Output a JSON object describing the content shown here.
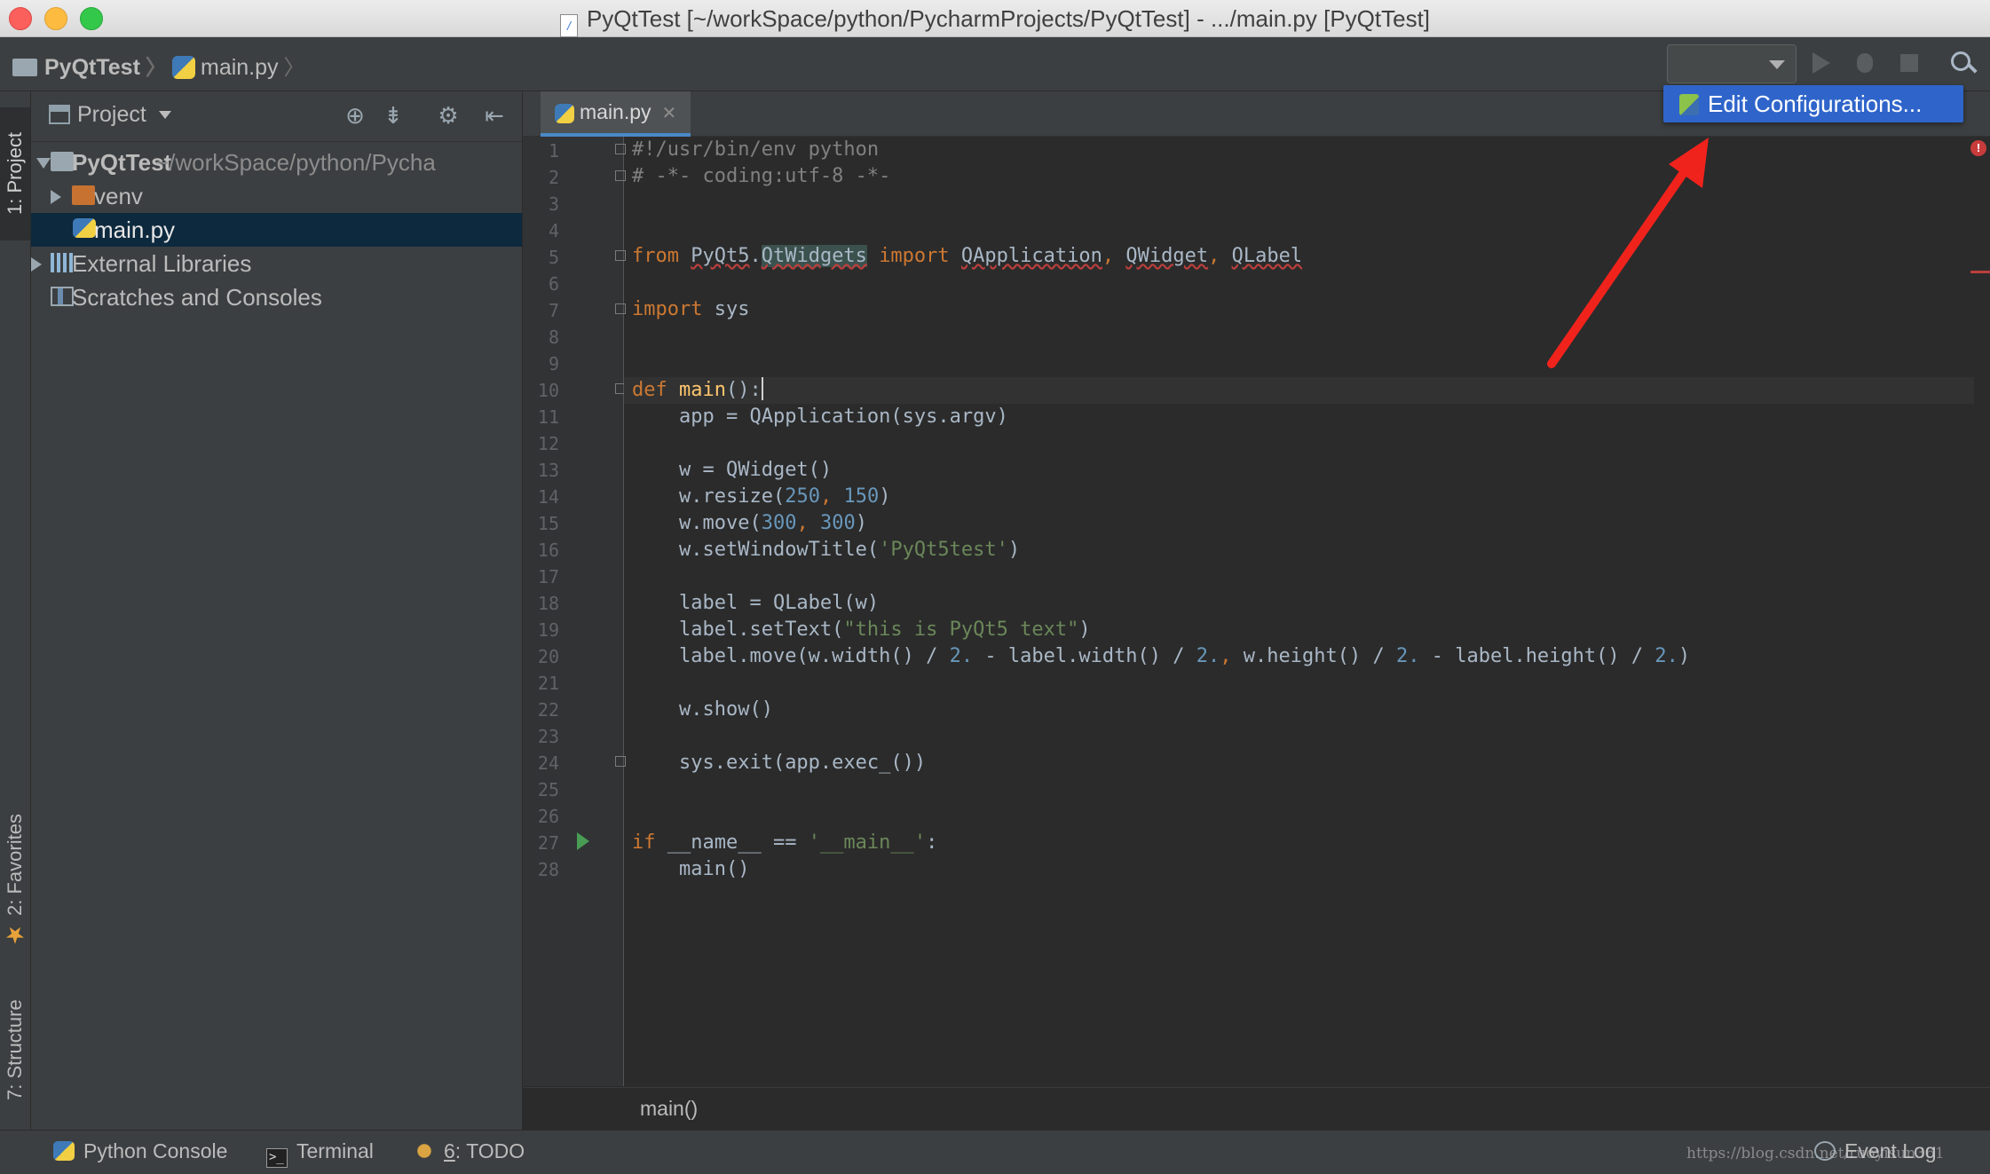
{
  "window": {
    "title": "PyQtTest [~/workSpace/python/PycharmProjects/PyQtTest] - .../main.py [PyQtTest]"
  },
  "navbar": {
    "breadcrumbs": [
      "PyQtTest",
      "main.py"
    ],
    "run_config_selected": "",
    "icons": [
      "run-icon",
      "debug-icon",
      "stop-icon",
      "search-icon"
    ]
  },
  "popup": {
    "edit_configurations_label": "Edit Configurations..."
  },
  "tool_windows": {
    "left": [
      "1: Project",
      "2: Favorites",
      "7: Structure"
    ],
    "bottom": {
      "python_console": "Python Console",
      "terminal": "Terminal",
      "todo_number": "6",
      "todo_label": ": TODO",
      "event_log": "Event Log"
    }
  },
  "project_panel": {
    "title": "Project",
    "tree": [
      {
        "label": "PyQtTest",
        "hint": "~/workSpace/python/Pycha",
        "expanded": true,
        "icon": "folder-icon"
      },
      {
        "label": "venv",
        "expanded": false,
        "icon": "folder-icon"
      },
      {
        "label": "main.py",
        "selected": true,
        "icon": "python-file-icon"
      },
      {
        "label": "External Libraries",
        "expanded": false,
        "icon": "library-icon"
      },
      {
        "label": "Scratches and Consoles",
        "icon": "scratches-icon"
      }
    ]
  },
  "editor": {
    "tab_label": "main.py",
    "line_numbers": [
      "1",
      "2",
      "3",
      "4",
      "5",
      "6",
      "7",
      "8",
      "9",
      "10",
      "11",
      "12",
      "13",
      "14",
      "15",
      "16",
      "17",
      "18",
      "19",
      "20",
      "21",
      "22",
      "23",
      "24",
      "25",
      "26",
      "27",
      "28"
    ],
    "breadcrumb": "main()",
    "code": {
      "l1": "#!/usr/bin/env python",
      "l2": "# -*- coding:utf-8 -*-",
      "l5_from": "from",
      "l5_pkg": "PyQt5",
      "l5_mod": "QtWidgets",
      "l5_import": "import",
      "l5_names": [
        "QApplication",
        "QWidget",
        "QLabel"
      ],
      "l7_import": "import",
      "l7_mod": "sys",
      "l10_def": "def",
      "l10_name": "main",
      "l10_rest": "():",
      "l11": "app = QApplication(sys.argv)",
      "l13": "w = QWidget()",
      "l14_pre": "w.resize(",
      "l14_a": "250",
      "l14_b": "150",
      "l15_pre": "w.move(",
      "l15_a": "300",
      "l15_b": "300",
      "l16_pre": "w.setWindowTitle(",
      "l16_str": "'PyQt5test'",
      "l18": "label = QLabel(w)",
      "l19_pre": "label.setText(",
      "l19_str": "\"this is PyQt5 text\"",
      "l20_a": "label.move(w.width() / ",
      "l20_b": " - label.width() / ",
      "l20_c": " w.height() / ",
      "l20_d": " - label.height() / ",
      "l20_num": "2.",
      "l22": "w.show()",
      "l24": "sys.exit(app.exec_())",
      "l27_if": "if",
      "l27_mid": " __name__ == ",
      "l27_str": "'__main__'",
      "l28": "main()"
    }
  },
  "watermark": "https://blog.csdn.net/ruoyisun361"
}
